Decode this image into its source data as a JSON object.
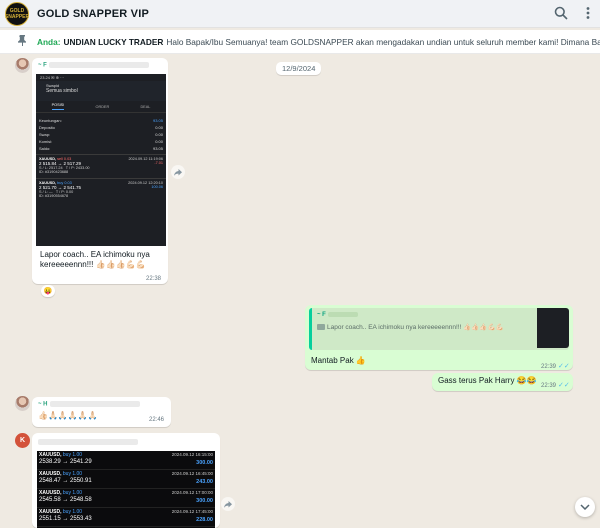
{
  "header": {
    "group_name": "GOLD SNAPPER VIP",
    "logo_text": "GOLD SNAPPER",
    "icons": [
      "search-icon",
      "menu-dots-icon"
    ]
  },
  "pinned": {
    "who": "Anda:",
    "bold": "UNDIAN LUCKY TRADER",
    "rest": "Halo Bapak/Ibu Semuanya! team GOLDSNAPPER akan mengadakan undian untuk seluruh member kami! Dimana Bapak dan I..."
  },
  "date_chip": "12/9/2024",
  "msg1": {
    "sender": "~ F",
    "text": "Lapor coach.. EA ichimoku nya kereeeeennn!!! 👍🏻👍🏻👍🏻💪🏻💪🏻",
    "time": "22:38",
    "reaction": "😛",
    "screenshot": {
      "statusbar": "23.24 ✉ ⊕ ···",
      "app_name": "Swapid",
      "app_sub": "Semua simbol",
      "tabs": [
        "POSISI",
        "ORDER",
        "DEAL"
      ],
      "summary": [
        {
          "k": "Keuntungan:",
          "v": "93.05"
        },
        {
          "k": "Deposito",
          "v": "0.00"
        },
        {
          "k": "Swap:",
          "v": "0.00"
        },
        {
          "k": "Komisi:",
          "v": "0.00"
        },
        {
          "k": "Saldo:",
          "v": "93.05"
        }
      ],
      "positions": [
        {
          "sym": "XAUUSD,",
          "side": "sell 0.03",
          "date": "2024.09.12 11:19:06",
          "prices": "2 515.84 → 2 517.29",
          "pnl": "-7.01",
          "sl": "2517.24",
          "tp": "2433.00",
          "id": "#3190423688",
          "type": "sell"
        },
        {
          "sym": "XAUUSD,",
          "side": "buy 0.03",
          "date": "2024.09.12 12:20:10",
          "prices": "2 521.70 → 2 541.75",
          "pnl": "100.06",
          "sl": "—",
          "tp": "0.00",
          "id": "#3190554678",
          "type": "buy"
        }
      ]
    }
  },
  "msg2": {
    "quote_sender": "~ F",
    "quote_text": "Lapor coach.. EA ichimoku nya kereeeeennn!!! 👍🏻👍🏻👍🏻💪🏻💪🏻",
    "text": "Mantab Pak 👍",
    "time": "22:39"
  },
  "msg3": {
    "text": "Gass terus Pak Harry 😂😂",
    "time": "22:39"
  },
  "msg4": {
    "sender": "~ H",
    "text": "👍🏻🙏🏻🙏🏻🙏🏻🙏🏻🙏🏻",
    "time": "22:46"
  },
  "msg5": {
    "avatar_letter": "K",
    "trades": [
      {
        "sym": "XAUUSD,",
        "side": "buy 1.00",
        "date": "2024.09.12 16:15:00",
        "prices": "2538.29 → 2541.29",
        "profit": "300.00"
      },
      {
        "sym": "XAUUSD,",
        "side": "buy 1.00",
        "date": "2024.09.12 16:45:00",
        "prices": "2548.47 → 2550.91",
        "profit": "243.00"
      },
      {
        "sym": "XAUUSD,",
        "side": "buy 1.00",
        "date": "2024.09.12 17:00:00",
        "prices": "2545.58 → 2548.58",
        "profit": "300.00"
      },
      {
        "sym": "XAUUSD,",
        "side": "buy 1.00",
        "date": "2024.09.12 17:45:00",
        "prices": "2551.15 → 2553.43",
        "profit": "228.00"
      }
    ]
  }
}
